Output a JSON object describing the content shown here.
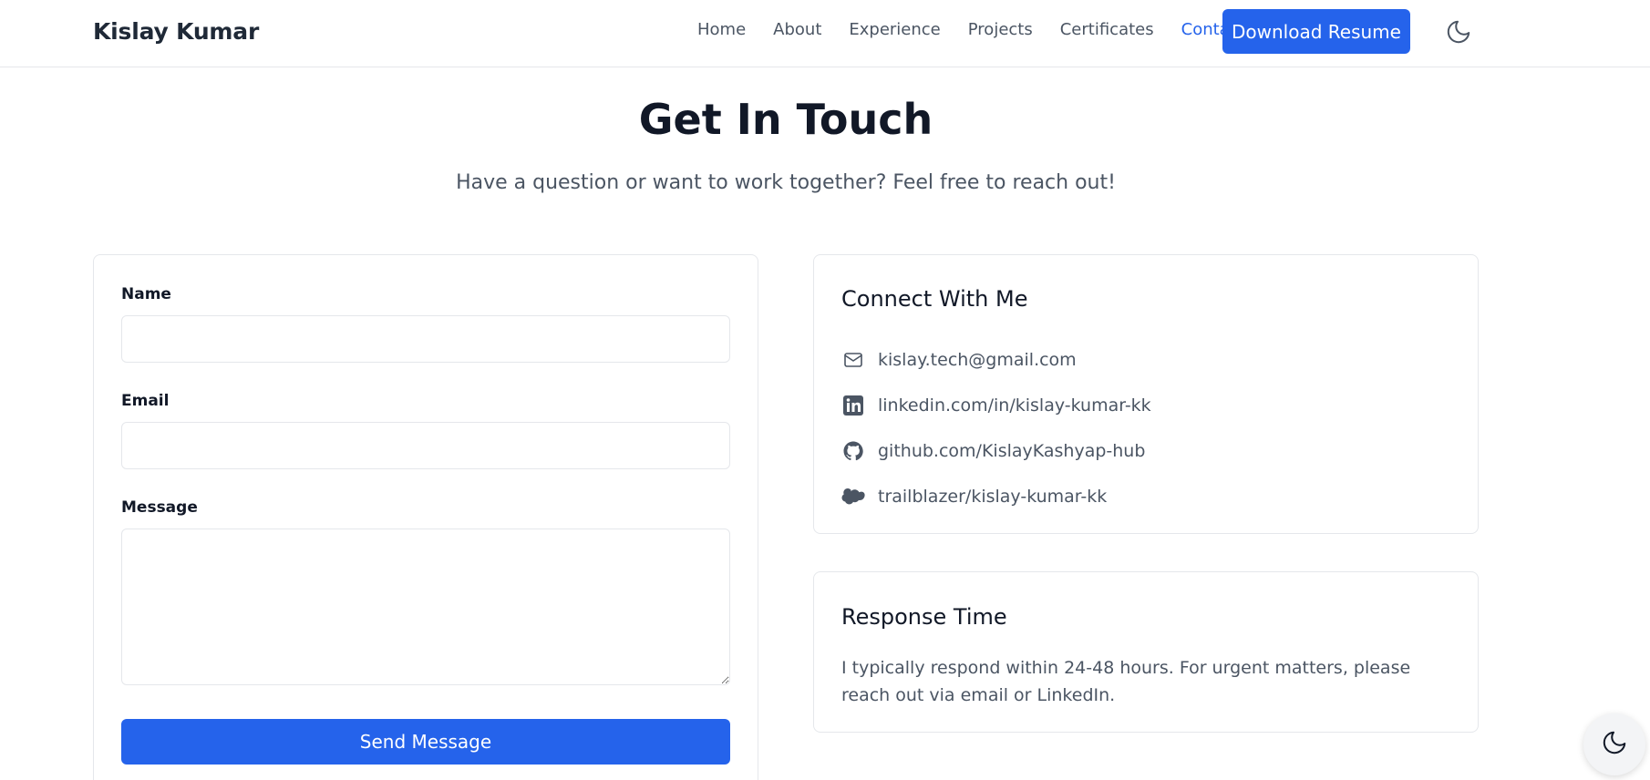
{
  "header": {
    "brand": "Kislay Kumar",
    "nav": [
      "Home",
      "About",
      "Experience",
      "Projects",
      "Certificates",
      "Contact"
    ],
    "active_nav": "Contact",
    "resume_button": "Download Resume"
  },
  "hero": {
    "title": "Get In Touch",
    "subtitle": "Have a question or want to work together? Feel free to reach out!"
  },
  "form": {
    "name_label": "Name",
    "name_value": "",
    "email_label": "Email",
    "email_value": "",
    "message_label": "Message",
    "message_value": "",
    "submit_label": "Send Message"
  },
  "connect": {
    "title": "Connect With Me",
    "items": [
      {
        "icon": "mail-icon",
        "text": "kislay.tech@gmail.com"
      },
      {
        "icon": "linkedin-icon",
        "text": "linkedin.com/in/kislay-kumar-kk"
      },
      {
        "icon": "github-icon",
        "text": "github.com/KislayKashyap-hub"
      },
      {
        "icon": "salesforce-cloud-icon",
        "text": "trailblazer/kislay-kumar-kk"
      }
    ]
  },
  "response": {
    "title": "Response Time",
    "text": "I typically respond within 24-48 hours. For urgent matters, please reach out via email or LinkedIn."
  },
  "colors": {
    "accent": "#2563eb",
    "text_dark": "#111827",
    "text_muted": "#4b5563",
    "border": "#e5e7eb"
  }
}
